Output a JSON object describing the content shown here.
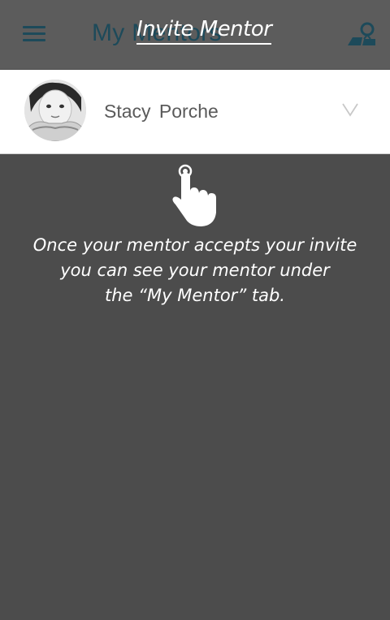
{
  "appbar": {
    "title": "My Mentors",
    "menu_icon": "hamburger-menu-icon",
    "profile_icon": "person-location-icon",
    "color": "#1d4a5a"
  },
  "mentor": {
    "name": "Stacy  Porche",
    "avatar_icon": "child-photo-avatar",
    "chevron_icon": "chevron-down-icon"
  },
  "coach": {
    "title": "Invite Mentor",
    "hand_icon": "tap-hand-icon",
    "lines": [
      "Once your mentor accepts your invite",
      "you can see your mentor under",
      "the “My Mentor” tab."
    ]
  },
  "colors": {
    "overlay": "#4c4c4c",
    "row_bg": "#ffffff",
    "name_text": "#5a5a5a"
  }
}
